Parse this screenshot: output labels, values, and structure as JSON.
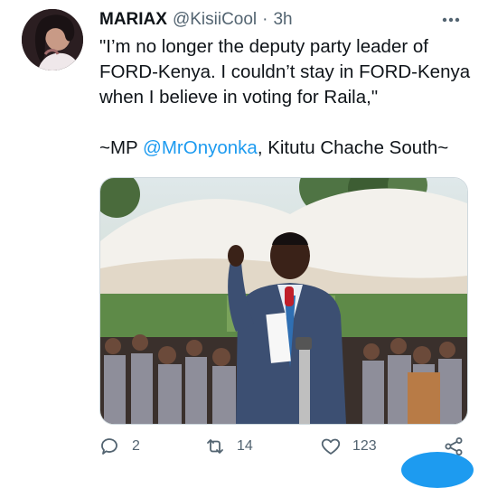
{
  "tweet": {
    "display_name": "MARIAX",
    "handle": "@KisiiCool",
    "separator": "·",
    "time": "3h",
    "line1": "\"I’m no longer the deputy party leader of FORD-Kenya. I couldn’t stay in FORD-Kenya when I believe in voting for Raila,\"",
    "line2_prefix": "~MP ",
    "line2_mention": "@MrOnyonka",
    "line2_suffix": ", Kitutu Chache South~"
  },
  "actions": {
    "replies": "2",
    "retweets": "14",
    "likes": "123"
  },
  "icons": {
    "more": "more-horizontal-icon",
    "reply": "reply-icon",
    "retweet": "retweet-icon",
    "like": "heart-icon",
    "share": "share-icon"
  },
  "colors": {
    "text": "#0f1419",
    "muted": "#536471",
    "accent": "#1d9bf0",
    "border": "#cfd9de"
  }
}
